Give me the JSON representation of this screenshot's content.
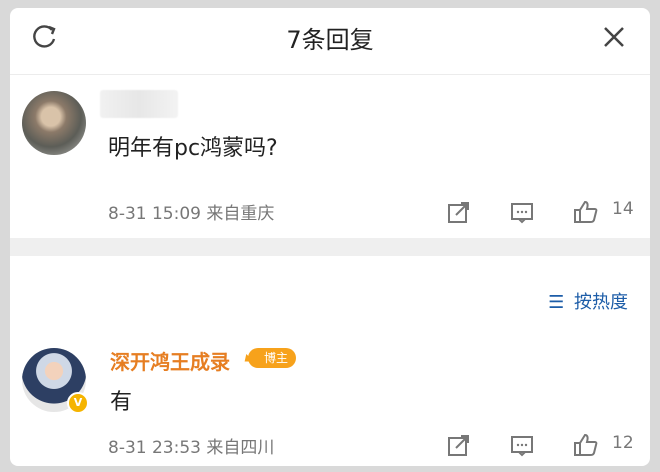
{
  "header": {
    "title": "7条回复"
  },
  "comments": [
    {
      "text": "明年有pc鸿蒙吗?",
      "date": "8-31 15:09",
      "location": "来自重庆",
      "likes": "14"
    }
  ],
  "sort": {
    "label": "按热度"
  },
  "reply": {
    "author": "深开鸿王成录",
    "badge": "博主",
    "text": "有",
    "date": "8-31 23:53",
    "location": "来自四川",
    "likes": "12"
  }
}
